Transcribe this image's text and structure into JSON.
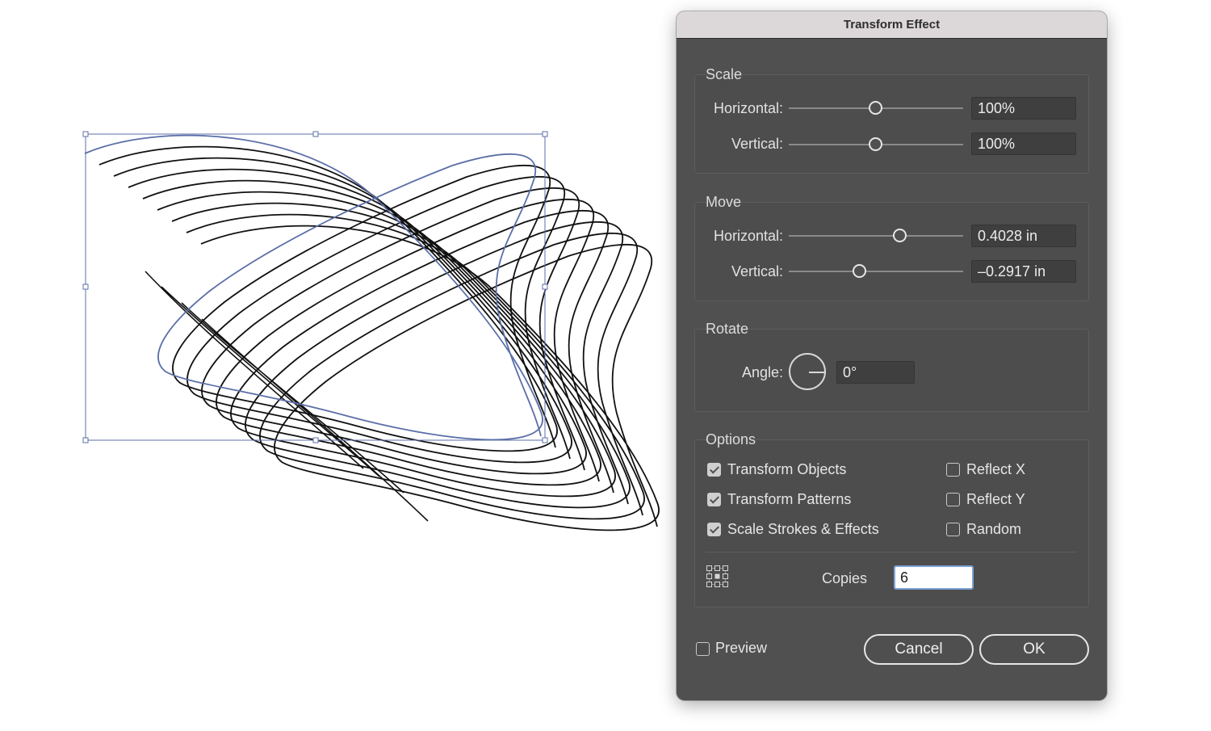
{
  "dialog": {
    "title": "Transform Effect",
    "scale": {
      "title": "Scale",
      "horizontal_label": "Horizontal:",
      "horizontal_value": "100%",
      "vertical_label": "Vertical:",
      "vertical_value": "100%"
    },
    "move": {
      "title": "Move",
      "horizontal_label": "Horizontal:",
      "horizontal_value": "0.4028 in",
      "vertical_label": "Vertical:",
      "vertical_value": "–0.2917 in"
    },
    "rotate": {
      "title": "Rotate",
      "angle_label": "Angle:",
      "angle_value": "0°"
    },
    "options": {
      "title": "Options",
      "transform_objects": {
        "label": "Transform Objects",
        "checked": true
      },
      "transform_patterns": {
        "label": "Transform Patterns",
        "checked": true
      },
      "scale_strokes": {
        "label": "Scale Strokes & Effects",
        "checked": true
      },
      "reflect_x": {
        "label": "Reflect X",
        "checked": false
      },
      "reflect_y": {
        "label": "Reflect Y",
        "checked": false
      },
      "random": {
        "label": "Random",
        "checked": false
      },
      "reference_point_icon": "reference-point-grid-icon",
      "copies_label": "Copies",
      "copies_value": "6"
    },
    "preview": {
      "label": "Preview",
      "checked": false
    },
    "cancel_label": "Cancel",
    "ok_label": "OK"
  },
  "colors": {
    "selection": "#5b6fa8",
    "dialog_bg": "#505050",
    "titlebar_bg": "#dcd8da",
    "focus_ring": "#7ea3d6"
  }
}
